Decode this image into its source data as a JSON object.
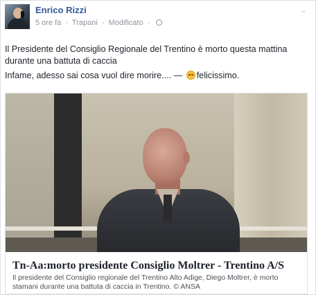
{
  "post": {
    "author": "Enrico Rizzi",
    "time": "5 ore fa",
    "location": "Trapani",
    "edited": "Modificato",
    "separator": "·",
    "text_line1": "Il Presidente del Consiglio Regionale del Trentino è morto questa mattina durante una battuta di caccia",
    "text_line2_before": "Infame, adesso sai cosa vuol dire morire.... —",
    "feeling": "felicissimo.",
    "icons": [
      "globe-icon",
      "chevron-down-icon",
      "laughing-emoji-icon"
    ]
  },
  "link": {
    "title": "Tn-Aa:morto presidente Consiglio Moltrer - Trentino A/S",
    "description": "Il presidente del Consiglio regionale del Trentino Alto Adige, Diego Moltrer, è morto stamani durante una battuta di caccia in Trentino. © ANSA"
  },
  "colors": {
    "author_link": "#365899",
    "meta_text": "#90949c",
    "body_text": "#1d2129"
  }
}
